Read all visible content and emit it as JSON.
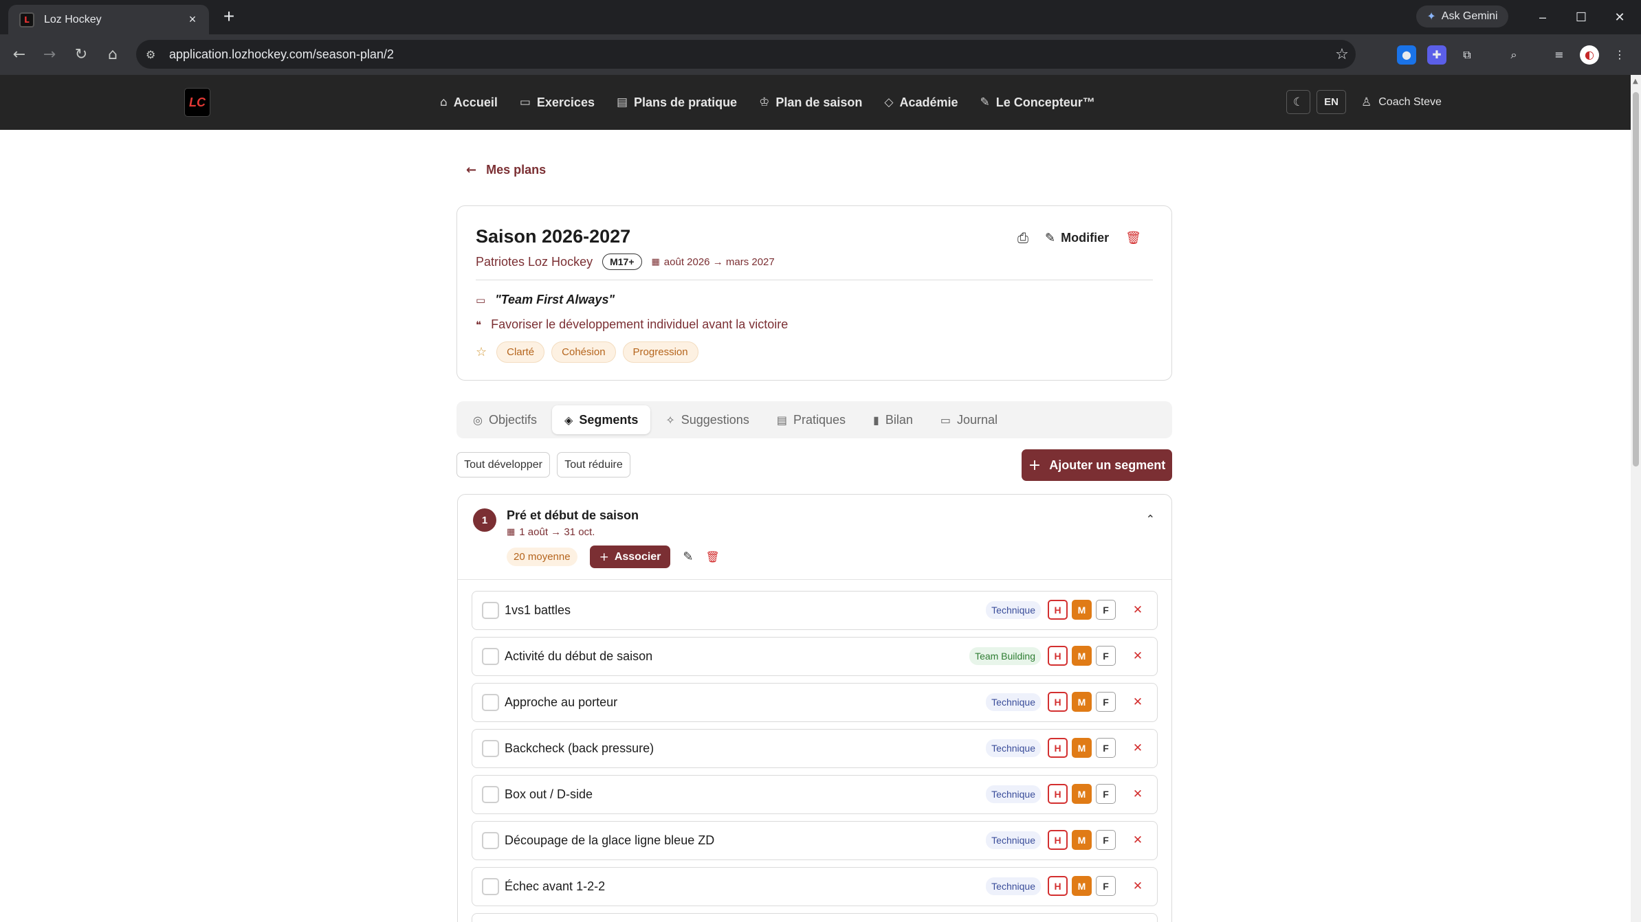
{
  "browser": {
    "tab_title": "Loz Hockey",
    "tab_close": "×",
    "new_tab": "+",
    "url": "application.lozhockey.com/season-plan/2",
    "gemini_label": "Ask Gemini",
    "window_controls": [
      "–",
      "☐",
      "✕"
    ]
  },
  "header": {
    "logo_mark": "LC",
    "nav": [
      {
        "label": "Accueil",
        "icon": "home-icon"
      },
      {
        "label": "Exercices",
        "icon": "book-icon"
      },
      {
        "label": "Plans de pratique",
        "icon": "clipboard-icon"
      },
      {
        "label": "Plan de saison",
        "icon": "trophy-icon"
      },
      {
        "label": "Académie",
        "icon": "graduation-cap-icon"
      },
      {
        "label": "Le Concepteur™",
        "icon": "pencil-icon"
      }
    ],
    "lang": "EN",
    "user": "Coach Steve"
  },
  "back_link": "Mes plans",
  "season": {
    "title": "Saison 2026-2027",
    "team": "Patriotes Loz Hockey",
    "age_group": "M17+",
    "dates": "août 2026 → mars 2027",
    "modify_label": "Modifier",
    "motto": "\"Team First Always\"",
    "philosophy": "Favoriser le développement individuel avant la victoire",
    "values": [
      "Clarté",
      "Cohésion",
      "Progression"
    ]
  },
  "tabs": [
    {
      "label": "Objectifs",
      "icon": "target-icon",
      "active": false
    },
    {
      "label": "Segments",
      "icon": "layers-icon",
      "active": true
    },
    {
      "label": "Suggestions",
      "icon": "sparkles-icon",
      "active": false
    },
    {
      "label": "Pratiques",
      "icon": "clipboard-icon",
      "active": false
    },
    {
      "label": "Bilan",
      "icon": "bar-chart-icon",
      "active": false
    },
    {
      "label": "Journal",
      "icon": "book-open-icon",
      "active": false
    }
  ],
  "controls": {
    "expand_all": "Tout développer",
    "collapse_all": "Tout réduire",
    "add_segment": "Ajouter un segment"
  },
  "segment": {
    "number": "1",
    "title": "Pré et début de saison",
    "dates": "1 août → 31 oct.",
    "intensity": "20 moyenne",
    "associate_label": "Associer",
    "exercises": [
      {
        "name": "1vs1 battles",
        "category": "Technique",
        "type": "technique"
      },
      {
        "name": "Activité du début de saison",
        "category": "Team Building",
        "type": "team"
      },
      {
        "name": "Approche au porteur",
        "category": "Technique",
        "type": "technique"
      },
      {
        "name": "Backcheck (back pressure)",
        "category": "Technique",
        "type": "technique"
      },
      {
        "name": "Box out / D-side",
        "category": "Technique",
        "type": "technique"
      },
      {
        "name": "Découpage de la glace ligne bleue ZD",
        "category": "Technique",
        "type": "technique"
      },
      {
        "name": "Échec avant 1-2-2",
        "category": "Technique",
        "type": "technique"
      },
      {
        "name": "",
        "category": "",
        "type": "technique"
      }
    ],
    "difficulty_labels": {
      "h": "H",
      "m": "M",
      "f": "F"
    }
  },
  "colors": {
    "brand": "#7b2f33",
    "header_bg": "#252525",
    "medium_active": "#e07b16",
    "hard": "#d32f2f"
  }
}
